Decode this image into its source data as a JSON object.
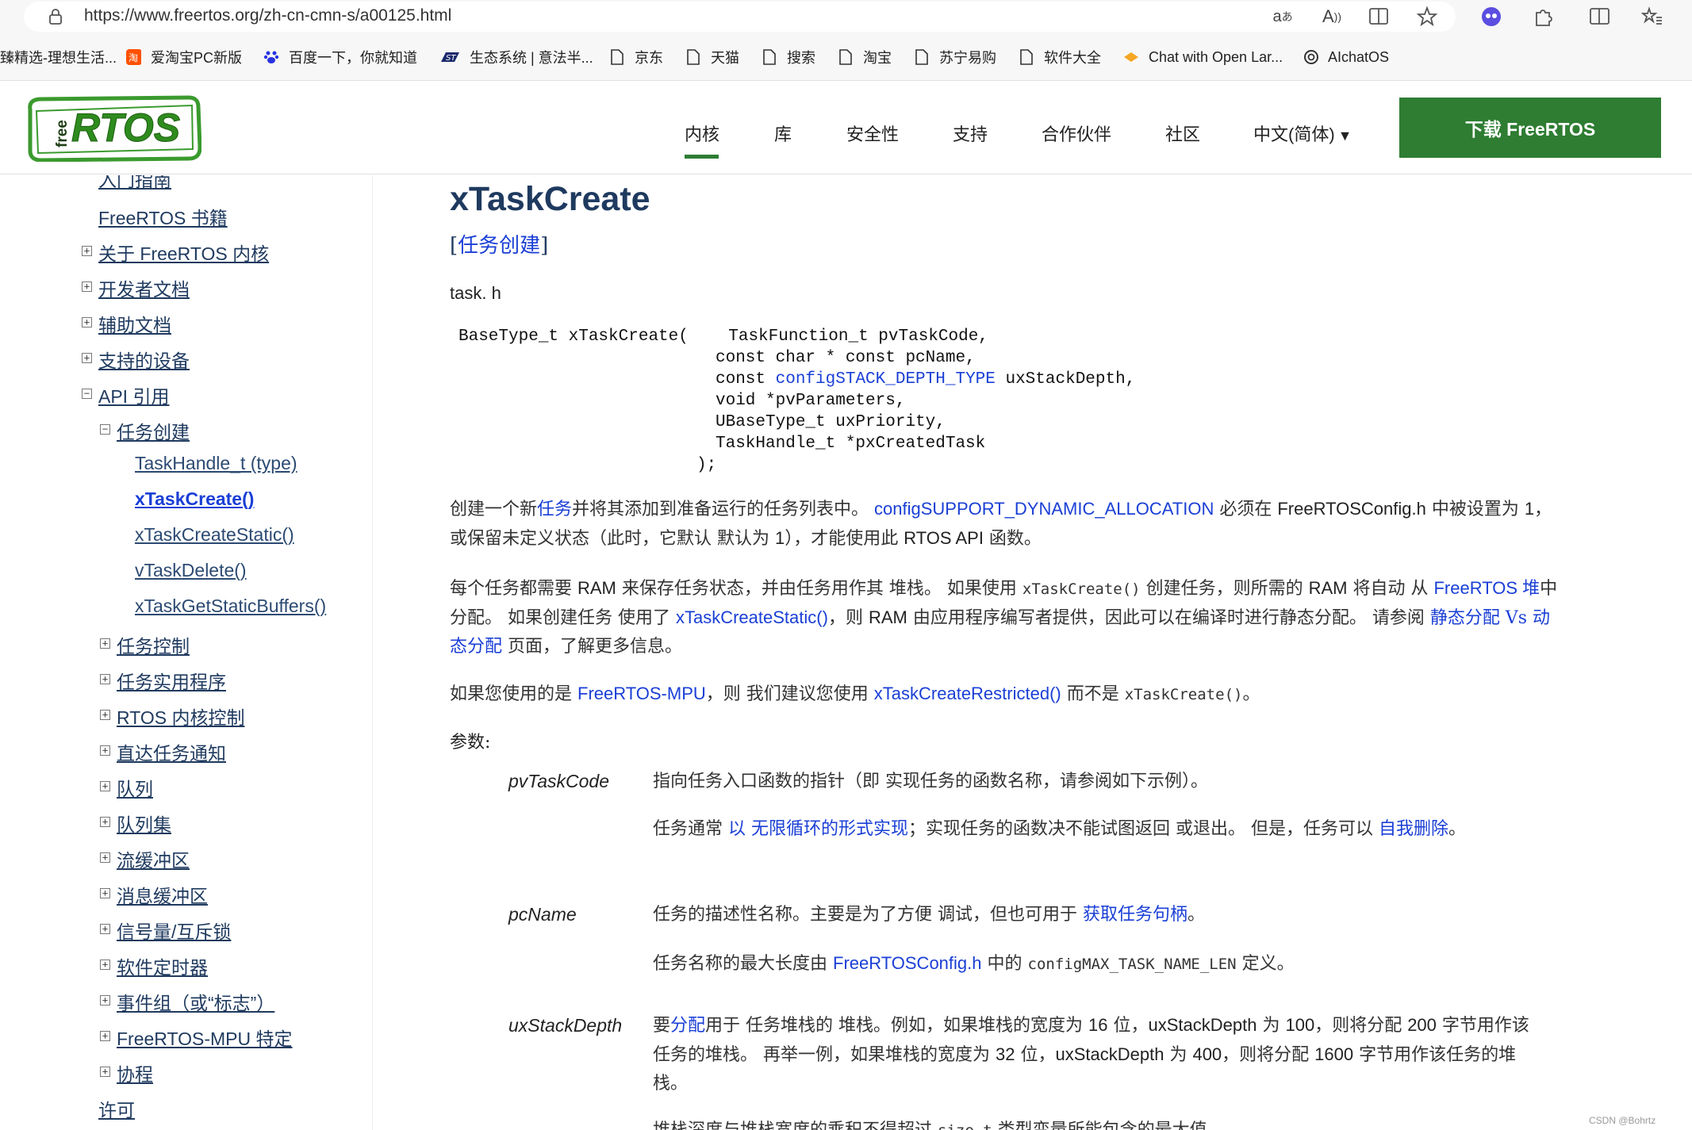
{
  "browser": {
    "url": "https://www.freertos.org/zh-cn-cmn-s/a00125.html"
  },
  "bookmarks": [
    {
      "label": "臻精选-理想生活...",
      "icon": "bookmark-icon"
    },
    {
      "label": "爱淘宝PC新版",
      "icon": "taobao-icon"
    },
    {
      "label": "百度一下，你就知道",
      "icon": "baidu-paw-icon"
    },
    {
      "label": "生态系统 | 意法半...",
      "icon": "st-logo-icon"
    },
    {
      "label": "京东",
      "icon": "page-icon"
    },
    {
      "label": "天猫",
      "icon": "page-icon"
    },
    {
      "label": "搜索",
      "icon": "page-icon"
    },
    {
      "label": "淘宝",
      "icon": "page-icon"
    },
    {
      "label": "苏宁易购",
      "icon": "page-icon"
    },
    {
      "label": "软件大全",
      "icon": "page-icon"
    },
    {
      "label": "Chat with Open Lar...",
      "icon": "chat-icon"
    },
    {
      "label": "AIchatOS",
      "icon": "openai-icon"
    }
  ],
  "header": {
    "logo_text": "RTOS",
    "logo_prefix": "free",
    "nav": [
      "内核",
      "库",
      "安全性",
      "支持",
      "合作伙伴",
      "社区",
      "中文(简体)"
    ],
    "download_label": "下载 FreeRTOS"
  },
  "sidebar": {
    "items": [
      "入门指南",
      "FreeRTOS 书籍",
      "关于 FreeRTOS 内核",
      "开发者文档",
      "辅助文档",
      "支持的设备",
      "API 引用",
      "任务创建",
      "TaskHandle_t (type)",
      "xTaskCreate()",
      "xTaskCreateStatic()",
      "vTaskDelete()",
      "xTaskGetStaticBuffers()",
      "任务控制",
      "任务实用程序",
      "RTOS 内核控制",
      "直达任务通知",
      "队列",
      "队列集",
      "流缓冲区",
      "消息缓冲区",
      "信号量/互斥锁",
      "软件定时器",
      "事件组（或“标志”）",
      "FreeRTOS-MPU 特定",
      "协程",
      "许可"
    ]
  },
  "main": {
    "title": "xTaskCreate",
    "subtitle_open": "[",
    "subtitle_link": "任务创建",
    "subtitle_close": "]",
    "header_file": "task. h",
    "prototype": {
      "l1": "BaseType_t xTaskCreate(    TaskFunction_t pvTaskCode,",
      "l2": "const char * const pcName,",
      "l3_a": "const ",
      "l3_link": "configSTACK_DEPTH_TYPE",
      "l3_b": " uxStackDepth,",
      "l4": "void *pvParameters,",
      "l5": "UBaseType_t uxPriority,",
      "l6": "TaskHandle_t *pxCreatedTask",
      "l7": ");"
    },
    "p1": {
      "a": "创建一个新",
      "link1": "任务",
      "b": "并将其添加到准备运行的任务列表中。 ",
      "link2": "configSUPPORT_DYNAMIC_ALLOCATION",
      "c": " 必须在 ",
      "en1": "FreeRTOSConfig.h",
      "d": " 中被设置为 ",
      "en2": "1",
      "e": "，或保留未定义状态（此时，它默认 默认为 ",
      "en3": "1",
      "f": "），才能使用此 ",
      "en4": "RTOS API",
      "g": " 函数。"
    },
    "p2": {
      "a": "每个任务都需要 ",
      "en1": "RAM",
      "b": " 来保存任务状态，并由任务用作其 堆栈。 如果使用 ",
      "mono1": "xTaskCreate()",
      "c": " 创建任务，则所需的 ",
      "en2": "RAM",
      "d": " 将自动 从 ",
      "link1": "FreeRTOS 堆",
      "e": "中分配。 如果创建任务 使用了 ",
      "link2": "xTaskCreateStatic()",
      "f": "，则 ",
      "en3": "RAM",
      "g": " 由应用程序编写者提供，因此可以在编译时进行静态分配。 请参阅 ",
      "link3": "静态分配 Vs 动态分配",
      "h": " 页面，了解更多信息。"
    },
    "p3": {
      "a": "如果您使用的是 ",
      "link1": "FreeRTOS-MPU",
      "b": "，则 我们建议您使用 ",
      "link2": "xTaskCreateRestricted()",
      "c": " 而不是 ",
      "mono1": "xTaskCreate()",
      "d": "。"
    },
    "params_heading": "参数:",
    "params": [
      {
        "name": "pvTaskCode",
        "desc1": "指向任务入口函数的指针（即 实现任务的函数名称，请参阅如下示例）。",
        "desc2_a": "任务通常 ",
        "desc2_link1": "以 无限循环的形式实现",
        "desc2_b": "；实现任务的函数决不能试图返回 或退出。 但是，任务可以 ",
        "desc2_link2": "自我删除",
        "desc2_c": "。"
      },
      {
        "name": "pcName",
        "desc1_a": "任务的描述性名称。主要是为了方便 调试，但也可用于 ",
        "desc1_link": "获取任务句柄",
        "desc1_b": "。",
        "desc2_a": "任务名称的最大长度由 ",
        "desc2_link": "FreeRTOSConfig.h",
        "desc2_b": " 中的 ",
        "desc2_mono": "configMAX_TASK_NAME_LEN",
        "desc2_c": " 定义。"
      },
      {
        "name": "uxStackDepth",
        "desc1_a": "要",
        "desc1_link": "分配",
        "desc1_b": "用于 任务堆栈的 堆栈。例如，如果堆栈的宽度为 ",
        "en1": "16",
        "desc1_c": " 位，",
        "en2": "uxStackDepth",
        "desc1_d": " 为 ",
        "en3": "100",
        "desc1_e": "，则将分配 ",
        "en4": "200",
        "desc1_f": " 字节用作该任务的堆栈。 再举一例，如果堆栈的宽度为 ",
        "en5": "32",
        "desc1_g": " 位，",
        "en6": "uxStackDepth",
        "desc1_h": " 为 ",
        "en7": "400",
        "desc1_i": "，则将分配 ",
        "en8": "1600",
        "desc1_j": " 字节用作该任务的堆栈。",
        "desc2_a": "堆栈深度与堆栈宽度的乘积不得超过 ",
        "desc2_mono": "size_t",
        "desc2_b": " 类型变量所能包含的最大值。"
      }
    ]
  },
  "watermark": "CSDN @Bohrtz",
  "colors": {
    "brand_green": "#2e7d32",
    "link_blue": "#1a3fd6",
    "heading_navy": "#1f3a5f"
  }
}
